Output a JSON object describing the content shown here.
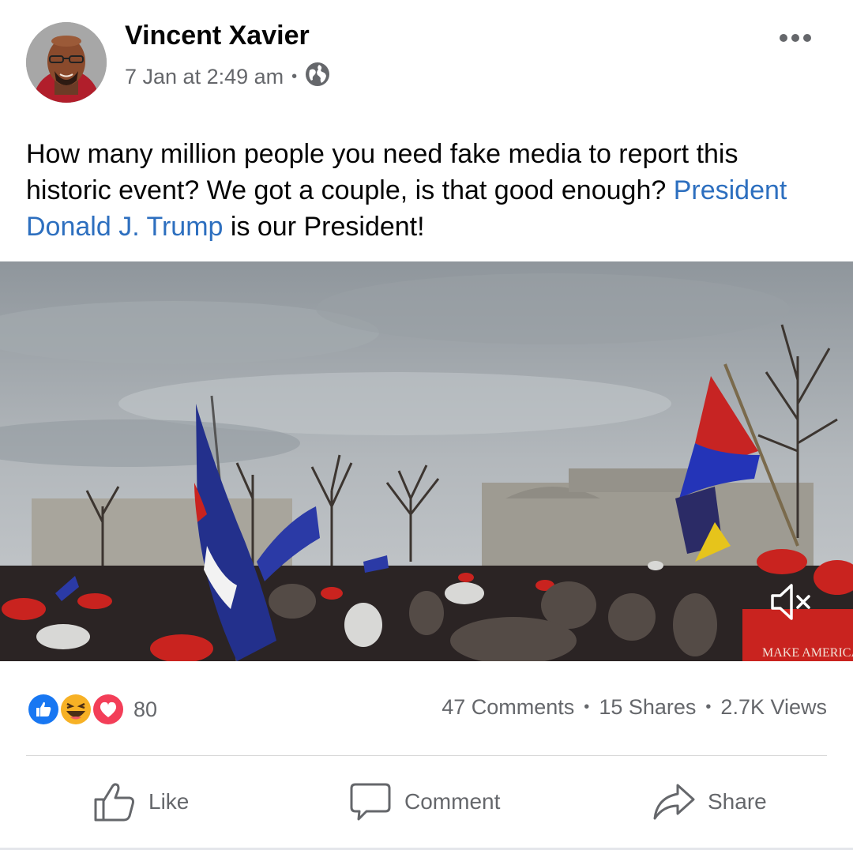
{
  "post": {
    "author": "Vincent Xavier",
    "timestamp": "7 Jan at 2:49 am",
    "meta_separator": "•",
    "privacy_icon": "globe-icon",
    "text_part1": "How many million people you need fake media to report this historic event? We got a couple, is that good enough? ",
    "mention": "President Donald J. Trump",
    "text_part2": " is our President!"
  },
  "media": {
    "type": "video",
    "muted": true,
    "overlay_text": "MAKE AMERICA"
  },
  "engagement": {
    "reaction_icons": [
      "like-icon",
      "haha-icon",
      "love-icon"
    ],
    "reaction_count": "80",
    "comments": "47 Comments",
    "shares": "15 Shares",
    "views": "2.7K Views",
    "separator": "•"
  },
  "actions": {
    "like": "Like",
    "comment": "Comment",
    "share": "Share"
  },
  "colors": {
    "link": "#2d6fbf",
    "secondary_text": "#65676b",
    "like_blue": "#1877f2",
    "love_red": "#f33e58",
    "haha_yellow": "#f7b125"
  }
}
